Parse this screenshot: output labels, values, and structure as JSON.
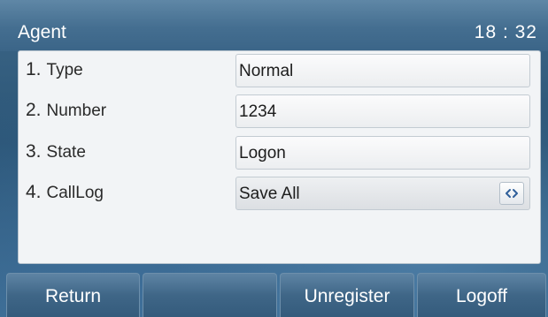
{
  "header": {
    "title": "Agent",
    "time": "18 : 32"
  },
  "rows": [
    {
      "num": "1.",
      "label": "Type",
      "value": "Normal"
    },
    {
      "num": "2.",
      "label": "Number",
      "value": "1234"
    },
    {
      "num": "3.",
      "label": "State",
      "value": "Logon"
    },
    {
      "num": "4.",
      "label": "CallLog",
      "value": "Save All",
      "control": "switch-arrows-icon"
    }
  ],
  "softkeys": {
    "return_label": "Return",
    "empty_label": "",
    "unregister_label": "Unregister",
    "logoff_label": "Logoff"
  },
  "colors": {
    "accent": "#3b6588",
    "switch_arrows": "#2f5f9a",
    "panel": "#f2f4f6"
  }
}
